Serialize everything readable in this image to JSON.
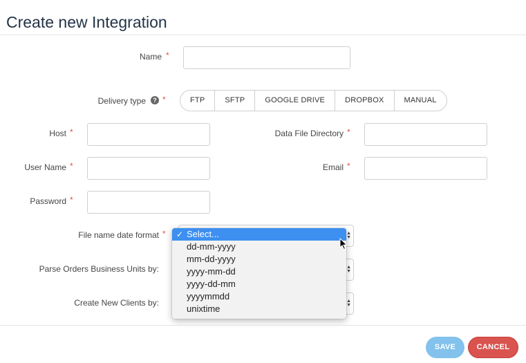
{
  "page": {
    "title": "Create new Integration"
  },
  "form": {
    "required_mark": "*",
    "name_label": "Name",
    "delivery_type_label": "Delivery type",
    "help_icon_glyph": "?",
    "delivery_options": [
      "FTP",
      "SFTP",
      "GOOGLE DRIVE",
      "DROPBOX",
      "MANUAL"
    ],
    "host_label": "Host",
    "data_file_directory_label": "Data File Directory",
    "user_name_label": "User Name",
    "email_label": "Email",
    "password_label": "Password",
    "file_name_date_format_label": "File name date format",
    "parse_orders_label": "Parse Orders Business Units by:",
    "create_new_clients_label": "Create New Clients by:"
  },
  "dropdown": {
    "options": [
      "Select...",
      "dd-mm-yyyy",
      "mm-dd-yyyy",
      "yyyy-mm-dd",
      "yyyy-dd-mm",
      "yyyymmdd",
      "unixtime"
    ],
    "selected_index": 0,
    "check_glyph": "✓",
    "highlight_color": "#3d8ff0"
  },
  "buttons": {
    "save": "SAVE",
    "cancel": "CANCEL"
  },
  "colors": {
    "title": "#243447",
    "required": "#d9534f",
    "save": "#82c2ec",
    "cancel": "#d9534f"
  }
}
